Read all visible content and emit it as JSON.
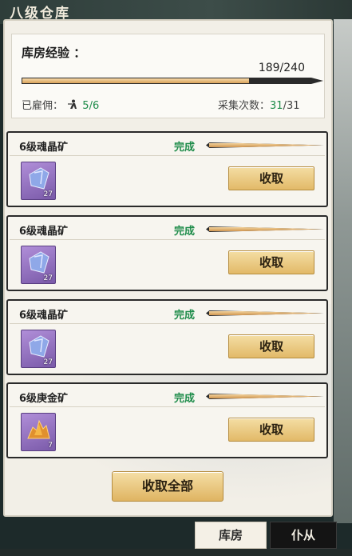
{
  "header": {
    "title": "八级仓库"
  },
  "experience": {
    "label": "库房经验 ：",
    "value_text": "189/240",
    "progress": 0.7875,
    "hired_label": "已雇佣：",
    "hired_value": "5/6",
    "collect_label": "采集次数：",
    "collect_current": "31",
    "collect_total": "/31"
  },
  "cards": [
    {
      "name": "6级魂晶矿",
      "status": "完成",
      "progress": 1.0,
      "item_icon": "crystal-ore-icon",
      "count": "27",
      "button": "收取"
    },
    {
      "name": "6级魂晶矿",
      "status": "完成",
      "progress": 1.0,
      "item_icon": "crystal-ore-icon",
      "count": "27",
      "button": "收取"
    },
    {
      "name": "6级魂晶矿",
      "status": "完成",
      "progress": 1.0,
      "item_icon": "crystal-ore-icon",
      "count": "27",
      "button": "收取"
    },
    {
      "name": "6级庚金矿",
      "status": "完成",
      "progress": 1.0,
      "item_icon": "gold-ore-icon",
      "count": "7",
      "button": "收取"
    }
  ],
  "collect_all": "收取全部",
  "tabs": [
    {
      "label": "库房",
      "active": true
    },
    {
      "label": "仆从",
      "active": false
    }
  ],
  "colors": {
    "accent_green": "#1e8c4a",
    "button_gold": "#e2b968",
    "panel": "#f2efe7"
  }
}
